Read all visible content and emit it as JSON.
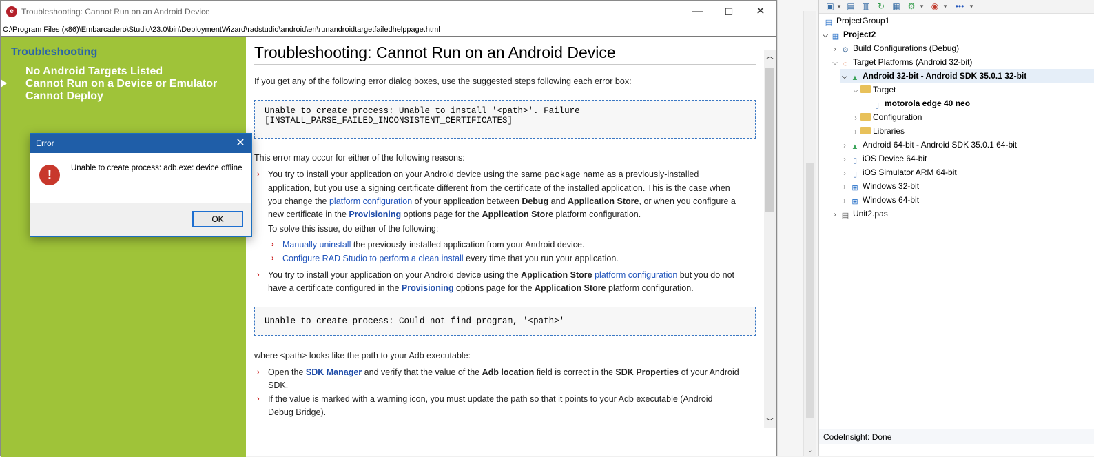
{
  "help_window": {
    "title": "Troubleshooting: Cannot Run on an Android Device",
    "url": "C:\\Program Files (x86)\\Embarcadero\\Studio\\23.0\\bin\\DeploymentWizard\\radstudio\\android\\en\\runandroidtargetfailedhelppage.html",
    "controls": {
      "minimize": "—",
      "maximize": "☐",
      "close": "✕"
    }
  },
  "toc": {
    "heading": "Troubleshooting",
    "items": [
      {
        "label": "No Android Targets Listed"
      },
      {
        "label": "Cannot Run on a Device or Emulator"
      },
      {
        "label": "Cannot Deploy"
      }
    ]
  },
  "content": {
    "title": "Troubleshooting: Cannot Run on an Android Device",
    "intro": "If you get any of the following error dialog boxes, use the suggested steps following each error box:",
    "error_box_1": {
      "line1": "Unable to create process: Unable to install '<path>'. Failure",
      "line2": "[INSTALL_PARSE_FAILED_INCONSISTENT_CERTIFICATES]"
    },
    "reasons_intro": "This error may occur for either of the following reasons:",
    "bullet1": {
      "t1": "You try to install your application on your Android device using the same ",
      "t1_mono": "package",
      "t2": " name as a previously-installed",
      "l2": "application, but you use a signing certificate different from the certificate of the installed application. This is the case when",
      "l3a": "you change the ",
      "l3_link": "platform configuration",
      "l3b": " of your application between ",
      "l3_debug": "Debug",
      "l3c": " and ",
      "l3_store": "Application Store",
      "l3d": ", or when you configure a",
      "l4a": "new certificate in the ",
      "l4_link": "Provisioning",
      "l4b": " options page for the ",
      "l4_store": "Application Store",
      "l4c": " platform configuration.",
      "solve": "To solve this issue, do either of the following:",
      "sub1_link": "Manually uninstall",
      "sub1_text": " the previously-installed application from your Android device.",
      "sub2_link": "Configure RAD Studio to perform a clean install",
      "sub2_text": " every time that you run your application."
    },
    "bullet2": {
      "a": "You try to install your application on your Android device using the ",
      "store": "Application Store",
      "b": " ",
      "link": "platform configuration",
      "c": " but you do not",
      "l2a": "have a certificate configured in the ",
      "l2_link": "Provisioning",
      "l2b": " options page for the ",
      "l2_store": "Application Store",
      "l2c": " platform configuration."
    },
    "error_box_2": "Unable to create process: Could not find program, '<path>'",
    "where_text": "where <path> looks like the path to your Adb executable:",
    "bullet3": {
      "a": "Open the ",
      "link": "SDK Manager",
      "b": " and verify that the value of the ",
      "adb": "Adb location",
      "c": " field is correct in the ",
      "props": "SDK Properties",
      "d": " of your Android",
      "l2": "SDK."
    },
    "bullet4": {
      "l1": "If the value is marked with a warning icon, you must update the path so that it points to your Adb executable (Android",
      "l2": "Debug Bridge)."
    }
  },
  "error_dialog": {
    "title": "Error",
    "message": "Unable to create process: adb.exe: device offline",
    "ok_label": "OK",
    "icon_glyph": "!"
  },
  "project_tree": {
    "nodes": [
      {
        "label": "ProjectGroup1"
      },
      {
        "label": "Project2"
      },
      {
        "label": "Build Configurations (Debug)"
      },
      {
        "label": "Target Platforms (Android 32-bit)"
      },
      {
        "label": "Android 32-bit - Android SDK 35.0.1 32-bit"
      },
      {
        "label": "Target"
      },
      {
        "label": "motorola edge 40 neo"
      },
      {
        "label": "Configuration"
      },
      {
        "label": "Libraries"
      },
      {
        "label": "Android 64-bit - Android SDK 35.0.1 64-bit"
      },
      {
        "label": "iOS Device 64-bit"
      },
      {
        "label": "iOS Simulator ARM 64-bit"
      },
      {
        "label": "Windows 32-bit"
      },
      {
        "label": "Windows 64-bit"
      },
      {
        "label": "Unit2.pas"
      }
    ],
    "status": "CodeInsight: Done"
  },
  "colors": {
    "toc_bg": "#9fc339",
    "toc_heading": "#2a63a8",
    "link": "#2255bb",
    "dialog_title_bg": "#1f5ea8",
    "error_icon": "#c8382c"
  }
}
